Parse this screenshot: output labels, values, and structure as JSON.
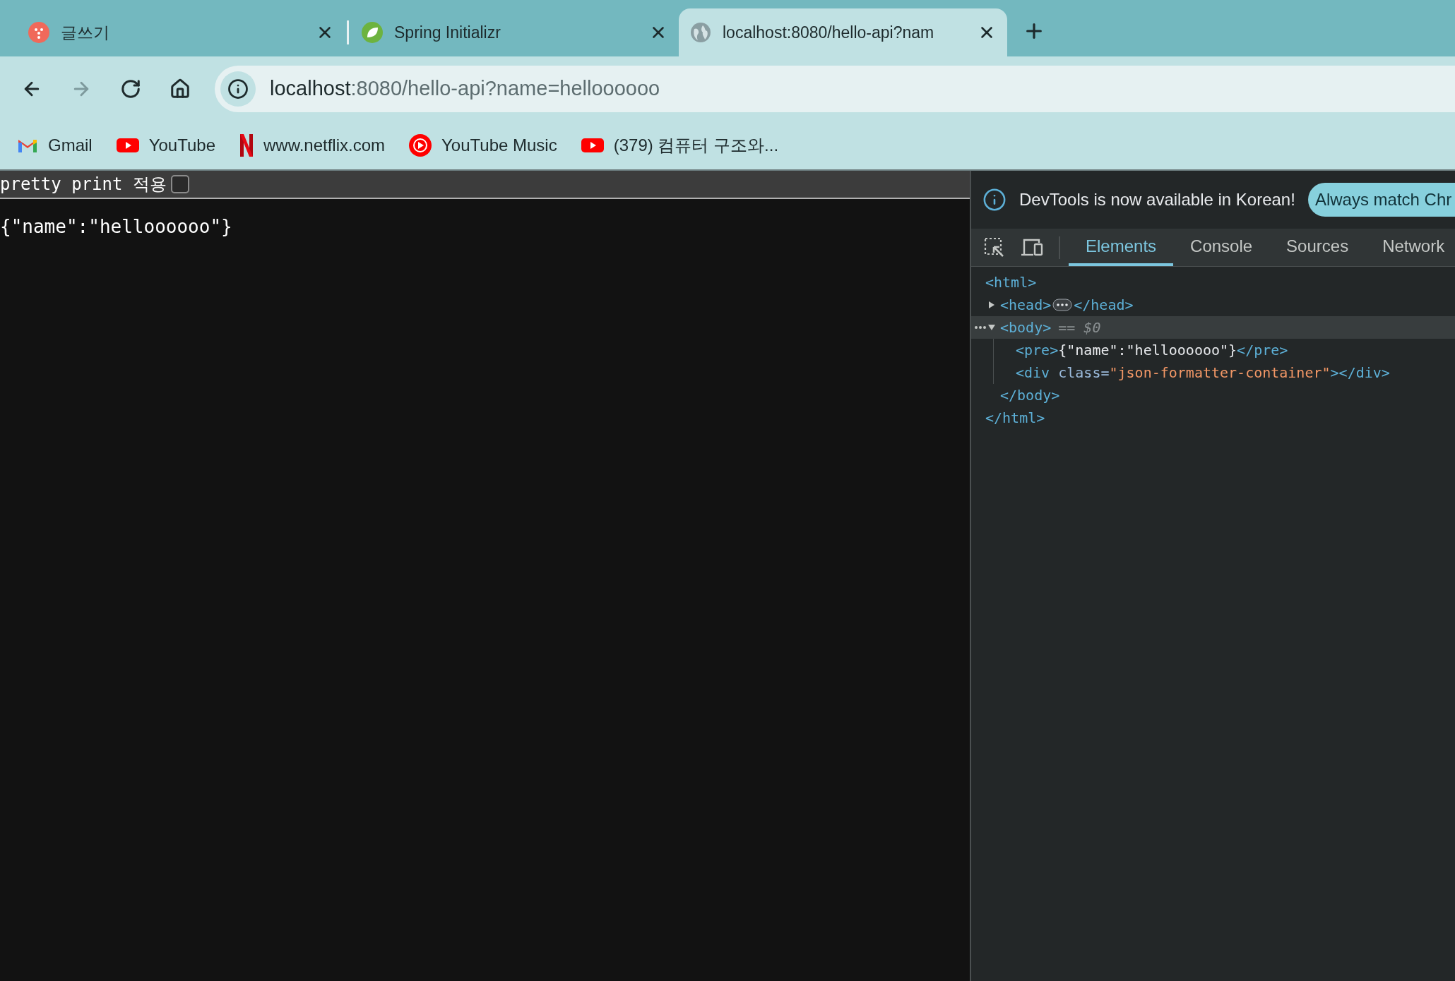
{
  "tabs": [
    {
      "title": "글쓰기",
      "selected": false
    },
    {
      "title": "Spring Initializr",
      "selected": false
    },
    {
      "title": "localhost:8080/hello-api?nam",
      "selected": true
    }
  ],
  "nav_buttons": [
    {
      "kind": "back",
      "disabled": false
    },
    {
      "kind": "forward",
      "disabled": true
    },
    {
      "kind": "reload",
      "disabled": false
    },
    {
      "kind": "home",
      "disabled": false
    }
  ],
  "address": {
    "host": "localhost",
    "rest": ":8080/hello-api?name=helloooooo"
  },
  "bookmarks": [
    {
      "label": "Gmail"
    },
    {
      "label": "YouTube"
    },
    {
      "label": "www.netflix.com"
    },
    {
      "label": "YouTube Music"
    },
    {
      "label": "(379) 컴퓨터 구조와..."
    }
  ],
  "page": {
    "toolbar_label": "pretty print 적용",
    "pretty_print_checked": false,
    "body": "{\"name\":\"helloooooo\"}"
  },
  "devtools": {
    "notice": "DevTools is now available in Korean!",
    "notice_button": "Always match Chr",
    "tabs": [
      {
        "label": "Elements",
        "selected": true
      },
      {
        "label": "Console",
        "selected": false
      },
      {
        "label": "Sources",
        "selected": false
      },
      {
        "label": "Network",
        "selected": false
      }
    ],
    "tree": [
      {
        "parts": [
          {
            "kind": "tag",
            "text": "<html>"
          }
        ],
        "selected": false,
        "expanded": true,
        "close": [
          {
            "kind": "tag",
            "text": "</html>"
          }
        ],
        "children": [
          {
            "parts": [
              {
                "kind": "tag",
                "text": "<head>"
              }
            ],
            "selected": false,
            "expanded": false,
            "close": [
              {
                "kind": "tag",
                "text": "</head>"
              }
            ]
          },
          {
            "parts": [
              {
                "kind": "tag",
                "text": "<body>"
              },
              {
                "kind": "marker",
                "text": "== $0"
              }
            ],
            "selected": true,
            "expanded": true,
            "close": [
              {
                "kind": "tag",
                "text": "</body>"
              }
            ],
            "children": [
              {
                "parts": [
                  {
                    "kind": "tag",
                    "text": "<pre>"
                  },
                  {
                    "kind": "text",
                    "text": "{\"name\":\"helloooooo\"}"
                  },
                  {
                    "kind": "tag",
                    "text": "</pre>"
                  }
                ],
                "selected": false
              },
              {
                "parts": [
                  {
                    "kind": "tag",
                    "text": "<div "
                  },
                  {
                    "kind": "attr",
                    "text": "class="
                  },
                  {
                    "kind": "value",
                    "text": "\"json-formatter-container\""
                  },
                  {
                    "kind": "tag",
                    "text": "></div>"
                  }
                ],
                "selected": false
              }
            ]
          }
        ]
      }
    ]
  }
}
